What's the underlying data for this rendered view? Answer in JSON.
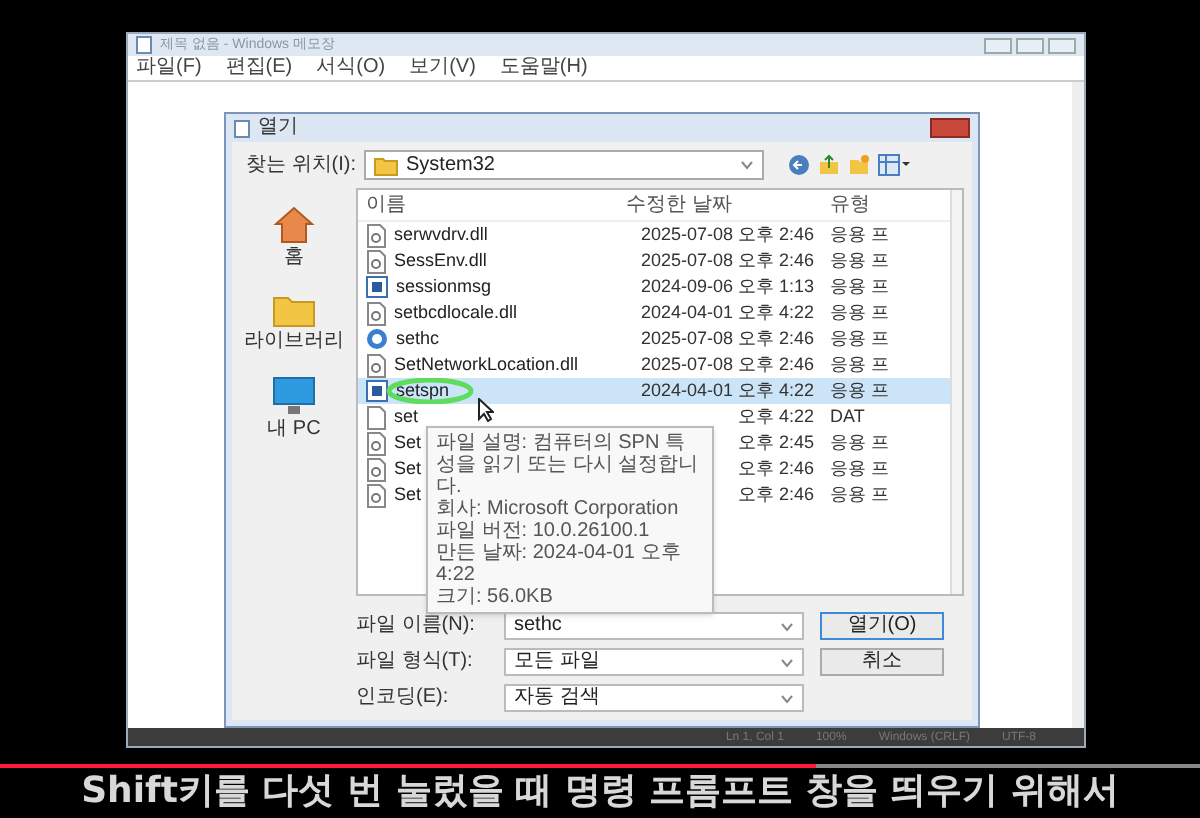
{
  "notepad": {
    "title": "제목 없음 - Windows 메모장",
    "menu": [
      "파일(F)",
      "편집(E)",
      "서식(O)",
      "보기(V)",
      "도움말(H)"
    ],
    "status_bar": [
      "Ln 1, Col 1",
      "100%",
      "Windows (CRLF)",
      "UTF-8"
    ]
  },
  "dialog": {
    "title": "열기",
    "look_in": {
      "label": "찾는 위치(I):",
      "value": "System32"
    },
    "places": [
      {
        "label": "홈",
        "kind": "home"
      },
      {
        "label": "라이브러리",
        "kind": "folder"
      },
      {
        "label": "내 PC",
        "kind": "pc"
      }
    ],
    "columns": [
      "이름",
      "수정한 날짜",
      "유형"
    ],
    "files": [
      {
        "name": "serwvdrv.dll",
        "modified": "2025-07-08 오후 2:46",
        "type": "응용 프",
        "kind": "dll",
        "selected": false
      },
      {
        "name": "SessEnv.dll",
        "modified": "2025-07-08 오후 2:46",
        "type": "응용 프",
        "kind": "dll",
        "selected": false
      },
      {
        "name": "sessionmsg",
        "modified": "2024-09-06 오후 1:13",
        "type": "응용 프",
        "kind": "app",
        "selected": false
      },
      {
        "name": "setbcdlocale.dll",
        "modified": "2024-04-01 오후 4:22",
        "type": "응용 프",
        "kind": "dll",
        "selected": false
      },
      {
        "name": "sethc",
        "modified": "2025-07-08 오후 2:46",
        "type": "응용 프",
        "kind": "access",
        "selected": false
      },
      {
        "name": "SetNetworkLocation.dll",
        "modified": "2025-07-08 오후 2:46",
        "type": "응용 프",
        "kind": "dll",
        "selected": false
      },
      {
        "name": "setspn",
        "modified": "2024-04-01 오후 4:22",
        "type": "응용 프",
        "kind": "app",
        "selected": true
      },
      {
        "name": "set",
        "modified": "오후 4:22",
        "type": "DAT",
        "kind": "blank",
        "selected": false
      },
      {
        "name": "Set",
        "modified": "오후 2:45",
        "type": "응용 프",
        "kind": "dll",
        "selected": false
      },
      {
        "name": "Set",
        "modified": "오후 2:46",
        "type": "응용 프",
        "kind": "dll",
        "selected": false
      },
      {
        "name": "Set",
        "modified": "오후 2:46",
        "type": "응용 프",
        "kind": "dll",
        "selected": false
      }
    ],
    "tooltip": [
      "파일 설명: 컴퓨터의 SPN 특성을 읽기 또는 다시 설정합니다.",
      "회사: Microsoft Corporation",
      "파일 버전: 10.0.26100.1",
      "만든 날짜: 2024-04-01 오후 4:22",
      "크기: 56.0KB"
    ],
    "fields": [
      {
        "label": "파일 이름(N):",
        "value": "sethc"
      },
      {
        "label": "파일 형식(T):",
        "value": "모든 파일"
      },
      {
        "label": "인코딩(E):",
        "value": "자동 검색"
      }
    ],
    "buttons": [
      "열기(O)",
      "취소"
    ]
  },
  "video": {
    "subtitle": "Shift키를 다섯 번 눌렀을 때 명령 프롬프트 창을 띄우기 위해서",
    "level": 0.68
  }
}
